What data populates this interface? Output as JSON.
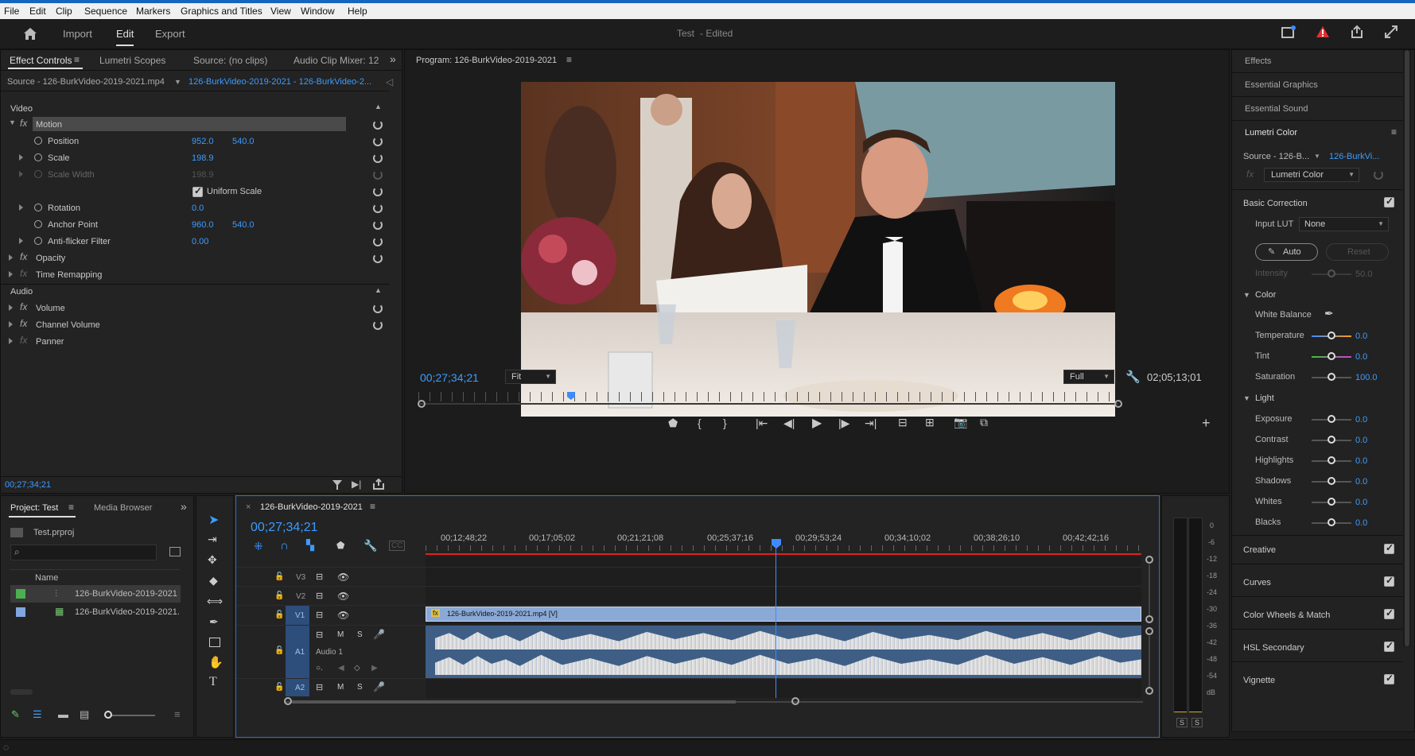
{
  "menu": [
    "File",
    "Edit",
    "Clip",
    "Sequence",
    "Markers",
    "Graphics and Titles",
    "View",
    "Window",
    "Help"
  ],
  "workspace": {
    "tabs": [
      "Import",
      "Edit",
      "Export"
    ],
    "active": "Edit",
    "project_title": "Test",
    "edited_label": "- Edited"
  },
  "effect_controls": {
    "tabs": [
      "Effect Controls",
      "Lumetri Scopes",
      "Source: (no clips)",
      "Audio Clip Mixer: 12"
    ],
    "source": "Source - 126-BurkVideo-2019-2021.mp4",
    "sequence": "126-BurkVideo-2019-2021 - 126-BurkVideo-2...",
    "video_header": "Video",
    "motion": "Motion",
    "position_label": "Position",
    "position_x": "952.0",
    "position_y": "540.0",
    "scale_label": "Scale",
    "scale": "198.9",
    "scale_width_label": "Scale Width",
    "scale_width": "198.9",
    "uniform_scale": "Uniform Scale",
    "rotation_label": "Rotation",
    "rotation": "0.0",
    "anchor_label": "Anchor Point",
    "anchor_x": "960.0",
    "anchor_y": "540.0",
    "antiflicker_label": "Anti-flicker Filter",
    "antiflicker": "0.00",
    "opacity": "Opacity",
    "time_remap": "Time Remapping",
    "audio_header": "Audio",
    "volume": "Volume",
    "channel_volume": "Channel Volume",
    "panner": "Panner",
    "timecode": "00;27;34;21"
  },
  "program": {
    "title": "Program: 126-BurkVideo-2019-2021",
    "timecode": "00;27;34;21",
    "fit": "Fit",
    "quality": "Full",
    "duration": "02;05;13;01",
    "playhead_fraction": 0.218
  },
  "effects_panel": {
    "items": [
      "Effects",
      "Essential Graphics",
      "Essential Sound",
      "Lumetri Color"
    ],
    "source": "Source - 126-B...",
    "clip": "126-BurkVi...",
    "effect": "Lumetri Color",
    "basic_correction": "Basic Correction",
    "input_lut_label": "Input LUT",
    "input_lut": "None",
    "auto": "Auto",
    "reset": "Reset",
    "intensity_label": "Intensity",
    "intensity": "50.0",
    "color": "Color",
    "white_balance": "White Balance",
    "temperature_label": "Temperature",
    "temperature": "0.0",
    "tint_label": "Tint",
    "tint": "0.0",
    "saturation_label": "Saturation",
    "saturation": "100.0",
    "light": "Light",
    "exposure_label": "Exposure",
    "exposure": "0.0",
    "contrast_label": "Contrast",
    "contrast": "0.0",
    "highlights_label": "Highlights",
    "highlights": "0.0",
    "shadows_label": "Shadows",
    "shadows": "0.0",
    "whites_label": "Whites",
    "whites": "0.0",
    "blacks_label": "Blacks",
    "blacks": "0.0",
    "sections": [
      "Creative",
      "Curves",
      "Color Wheels & Match",
      "HSL Secondary",
      "Vignette"
    ]
  },
  "project": {
    "tabs": [
      "Project: Test",
      "Media Browser"
    ],
    "file": "Test.prproj",
    "name_header": "Name",
    "items": [
      "126-BurkVideo-2019-2021",
      "126-BurkVideo-2019-2021."
    ]
  },
  "timeline": {
    "tab": "126-BurkVideo-2019-2021",
    "timecode": "00;27;34;21",
    "ruler": [
      "00;12;48;22",
      "00;17;05;02",
      "00;21;21;08",
      "00;25;37;16",
      "00;29;53;24",
      "00;34;10;02",
      "00;38;26;10",
      "00;42;42;16"
    ],
    "tracks": [
      "V3",
      "V2",
      "V1",
      "A1",
      "A2"
    ],
    "clip": "126-BurkVideo-2019-2021.mp4 [V]",
    "audio_name": "Audio 1",
    "m": "M",
    "s": "S"
  },
  "meter": {
    "labels": [
      "0",
      "-6",
      "-12",
      "-18",
      "-24",
      "-30",
      "-36",
      "-42",
      "-48",
      "-54",
      "dB"
    ],
    "s": "S"
  }
}
